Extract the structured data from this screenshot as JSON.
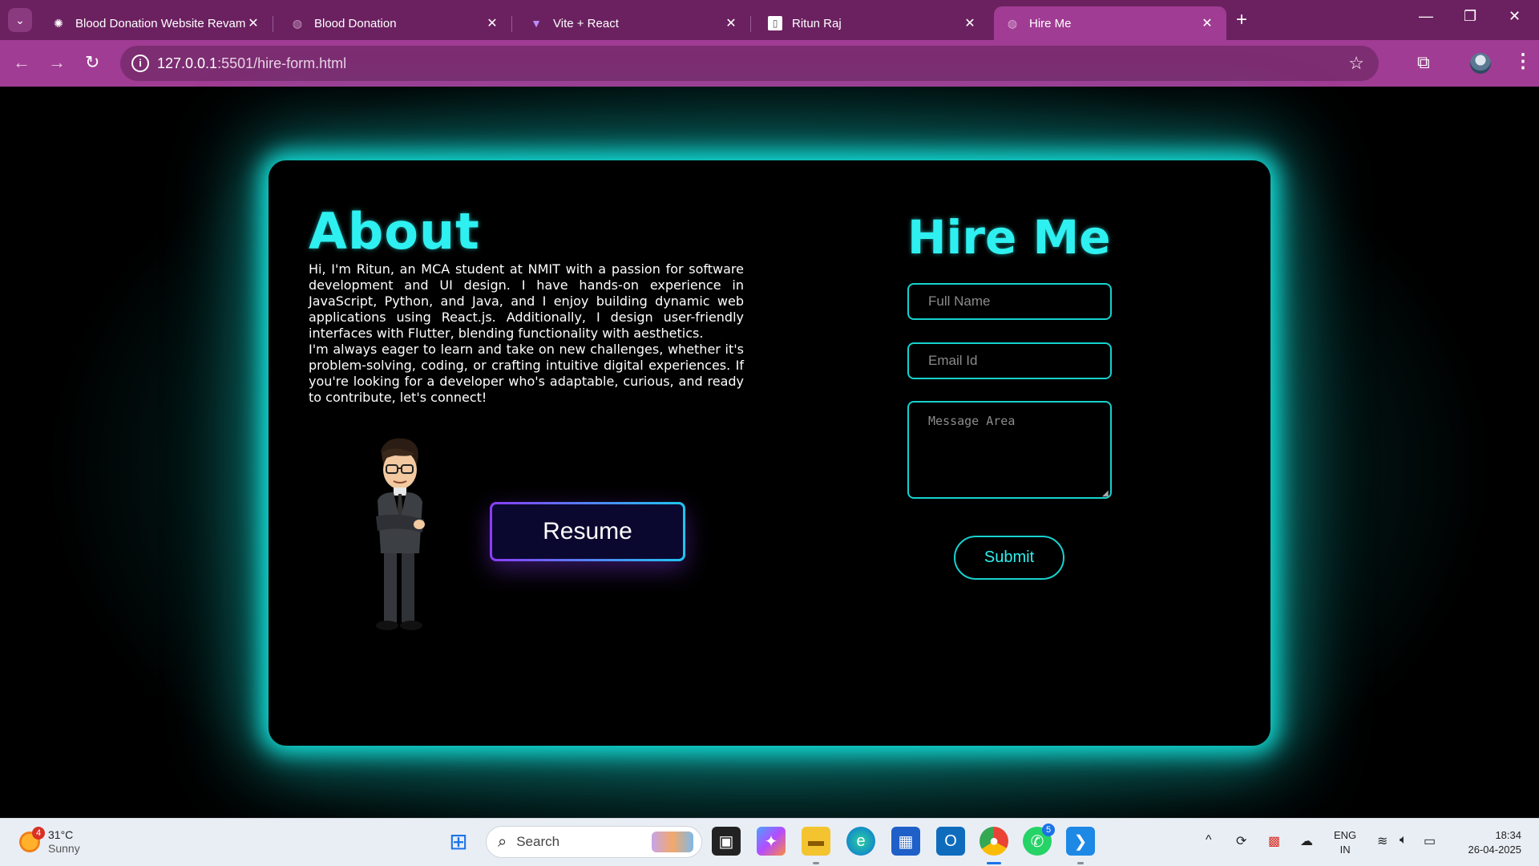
{
  "browser": {
    "tabs": [
      {
        "title": "Blood Donation Website Revam",
        "icon": "openai-icon"
      },
      {
        "title": "Blood Donation",
        "icon": "globe-icon"
      },
      {
        "title": "Vite + React",
        "icon": "vite-icon"
      },
      {
        "title": "Ritun Raj",
        "icon": "page-icon"
      },
      {
        "title": "Hire Me",
        "icon": "globe-icon",
        "active": true
      }
    ],
    "url_host": "127.0.0.1",
    "url_path": ":5501/hire-form.html"
  },
  "about": {
    "title": "About",
    "paragraph1": "Hi, I'm Ritun, an MCA student at NMIT with a passion for software development and UI design. I have hands-on experience in JavaScript, Python, and Java, and I enjoy building dynamic web applications using React.js. Additionally, I design user-friendly interfaces with Flutter, blending functionality with aesthetics.",
    "paragraph2": "I'm always eager to learn and take on new challenges, whether it's problem-solving, coding, or crafting intuitive digital experiences. If you're looking for a developer who's adaptable, curious, and ready to contribute, let's connect!",
    "resume_label": "Resume"
  },
  "hire": {
    "title": "Hire Me",
    "name_placeholder": "Full Name",
    "email_placeholder": "Email Id",
    "message_placeholder": "Message Area",
    "submit_label": "Submit"
  },
  "taskbar": {
    "weather_badge": "4",
    "temperature": "31°C",
    "condition": "Sunny",
    "search_label": "Search",
    "whatsapp_badge": "5",
    "lang_line1": "ENG",
    "lang_line2": "IN",
    "time": "18:34",
    "date": "26-04-2025"
  },
  "colors": {
    "accent_cyan": "#2ff0f0",
    "browser_frame": "#a03c93",
    "glow": "#13dcd6"
  }
}
